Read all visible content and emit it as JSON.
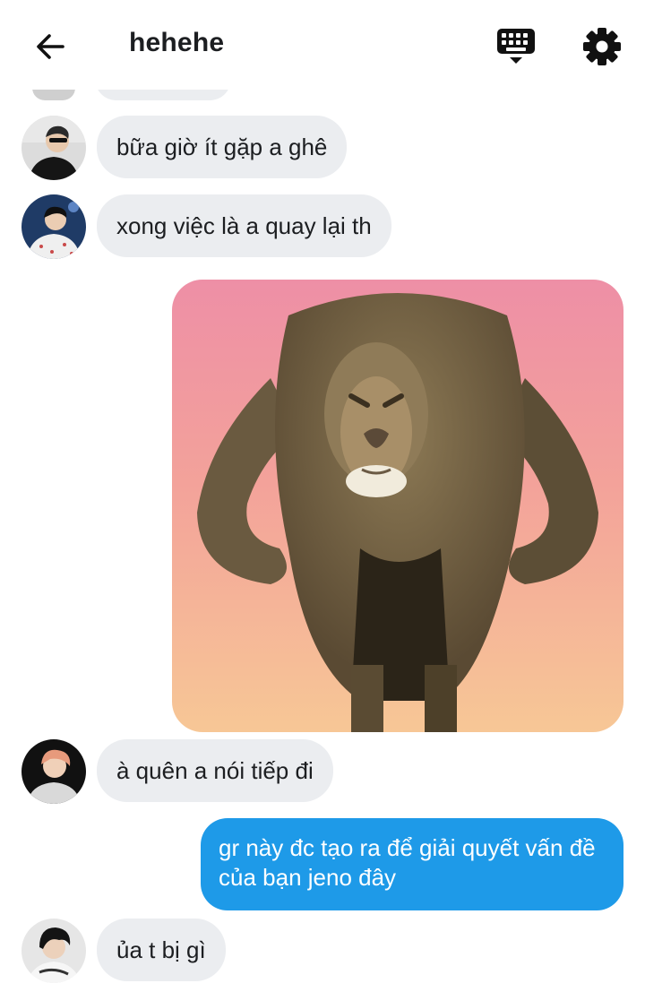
{
  "header": {
    "title": "hehehe",
    "back_icon": "arrow-left-icon",
    "keyboard_icon": "keyboard-icon",
    "settings_icon": "gear-icon"
  },
  "messages": [
    {
      "side": "incoming",
      "text": "bữa giờ ít gặp a ghê"
    },
    {
      "side": "incoming",
      "text": "xong việc là a quay lại th"
    },
    {
      "side": "outgoing",
      "type": "image",
      "image": "lion-meme-photo"
    },
    {
      "side": "incoming",
      "text": "à quên a nói tiếp đi"
    },
    {
      "side": "outgoing",
      "text": "gr này đc tạo ra để giải quyết vấn đề của bạn jeno đây"
    },
    {
      "side": "incoming",
      "text": "ủa t bị gì"
    }
  ],
  "colors": {
    "incoming_bubble": "#ebedf0",
    "outgoing_bubble": "#1e9ae8",
    "text_dark": "#1c1e21"
  }
}
